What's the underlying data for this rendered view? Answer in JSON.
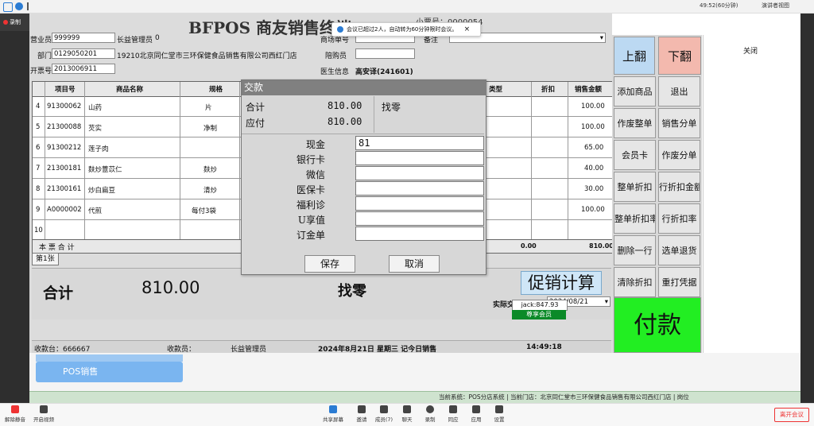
{
  "meeting": {
    "timer": "49:52(60分钟)",
    "presenter_view": "演讲者视图",
    "recording": "录制",
    "notice": "会议已超过2人，自动转为60分钟限时会议。",
    "leave": "离开会议",
    "toolbar": [
      "解除静音",
      "开启视频",
      "共享屏幕",
      "邀请",
      "成员(7)",
      "聊天",
      "录制",
      "同应",
      "应用",
      "设置"
    ]
  },
  "pos": {
    "title": "BFPOS 商友销售终端",
    "ticket_label": "小票号：0000054",
    "fields": {
      "cashier_label": "营业员",
      "cashier_value": "999999",
      "cashier_name": "长益管理员",
      "cashier_flag": "0",
      "dept_label": "部门",
      "dept_value": "0129050201",
      "dept_name": "19210北京同仁堂市三环保健食品销售有限公司西红门店",
      "invoice_label": "开票号",
      "invoice_value": "2013006911",
      "market_label": "商场单号",
      "remark_label": "备注",
      "companion_label": "陪购员",
      "doctor_label": "医生信息",
      "doctor_value": "高安译(241601)"
    },
    "table": {
      "headers": [
        "项目号",
        "商品名称",
        "规格",
        "类型",
        "折扣",
        "销售金额"
      ],
      "rows": [
        {
          "no": "4",
          "code": "91300062",
          "name": "山药",
          "spec": "片",
          "amount": "100.00"
        },
        {
          "no": "5",
          "code": "21300088",
          "name": "芡实",
          "spec": "净制",
          "amount": "100.00"
        },
        {
          "no": "6",
          "code": "91300212",
          "name": "莲子肉",
          "spec": "",
          "amount": "65.00"
        },
        {
          "no": "7",
          "code": "21300181",
          "name": "麸炒薏苡仁",
          "spec": "麸炒",
          "amount": "40.00"
        },
        {
          "no": "8",
          "code": "21300161",
          "name": "炒白扁豆",
          "spec": "清炒",
          "amount": "30.00"
        },
        {
          "no": "9",
          "code": "A0000002",
          "name": "代煎",
          "spec": "每付3袋",
          "amount": "100.00"
        },
        {
          "no": "10",
          "code": "",
          "name": "",
          "spec": "",
          "amount": ""
        }
      ],
      "total_label": "本  票  合  计",
      "total_discount": "0.00",
      "total_amount": "810.00"
    },
    "sheet_tab": "第1张",
    "summary": {
      "total_label": "合计",
      "total_value": "810.00",
      "change_label": "找零",
      "promo_button": "促销计算",
      "date_label": "实际交易日期",
      "date_value": "2024/08/21",
      "member_value": "jack:847.93",
      "member_button": "尊享会员"
    },
    "status": {
      "till": "收款台：666667",
      "receiver_label": "收款员：",
      "receiver_name": "长益管理员",
      "date": "2024年8月21日 星期三 记今日销售",
      "time": "14:49:18"
    },
    "dialog": {
      "title": "交款",
      "total_label": "合计",
      "total_value": "810.00",
      "due_label": "应付",
      "due_value": "810.00",
      "change_label": "找零",
      "payments": [
        {
          "label": "现金",
          "value": "81"
        },
        {
          "label": "银行卡",
          "value": ""
        },
        {
          "label": "微信",
          "value": ""
        },
        {
          "label": "医保卡",
          "value": ""
        },
        {
          "label": "福利诊",
          "value": ""
        },
        {
          "label": "U享值",
          "value": ""
        },
        {
          "label": "订金单",
          "value": ""
        }
      ],
      "save": "保存",
      "cancel": "取消"
    },
    "buttons": {
      "page_up": "上翻",
      "page_down": "下翻",
      "add_item": "添加商品",
      "exit": "退出",
      "void_all": "作废整单",
      "sales_split": "销售分单",
      "member_card": "会员卡",
      "void_split": "作废分单",
      "order_discount": "整单折扣",
      "line_discount_amount": "行折扣金额",
      "order_discount_rate": "整单折扣率",
      "line_discount_rate": "行折扣率",
      "delete_line": "删除一行",
      "select_return": "选单退货",
      "clear_discount": "清除折扣",
      "reprint": "重打凭据",
      "pay": "付款"
    },
    "side": {
      "close": "关闭"
    },
    "lower": {
      "menu": "POS销售",
      "footer": "当前系统：POS分店系统 | 当前门店：北京同仁堂市三环保健食品销售有限公司西红门店 | 岗位"
    }
  }
}
